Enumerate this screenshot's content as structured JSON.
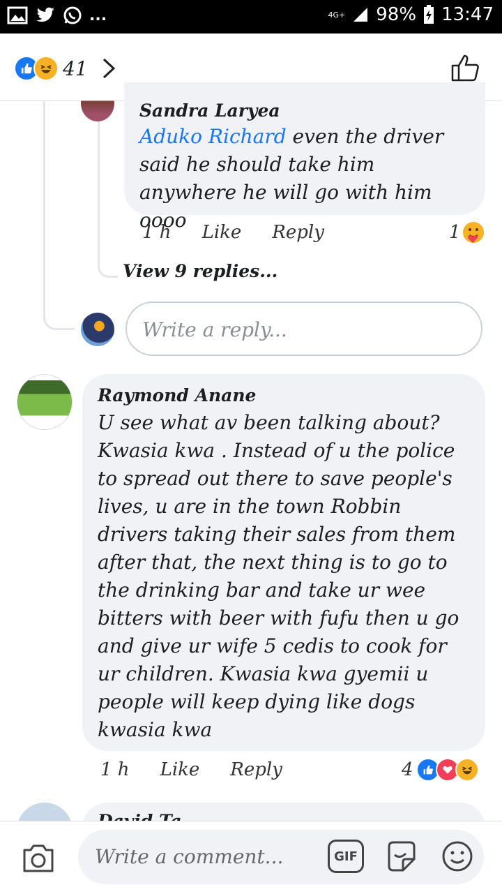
{
  "status_bar": {
    "network": "4G+",
    "battery": "98%",
    "time": "13:47",
    "more": "..."
  },
  "header": {
    "reaction_count": "41",
    "reaction_icons": [
      "like-icon",
      "haha-icon"
    ]
  },
  "reply_comment": {
    "author": "Sandra Laryea",
    "mention": "Aduko Richard",
    "text": " even the driver said he should take him anywhere he will go with him oooo",
    "time": "1 h",
    "like_label": "Like",
    "reply_label": "Reply",
    "reaction_count": "1"
  },
  "view_replies": "View 9 replies...",
  "reply_input": {
    "placeholder": "Write a reply..."
  },
  "main_comment": {
    "author": "Raymond Anane",
    "text": "U see what av been talking about? Kwasia kwa . Instead of u the police to spread out there to save people's lives, u are in the town Robbin drivers taking their sales from them after that, the next thing is to go to the drinking bar and take ur wee bitters with beer with fufu then u go and give ur wife 5 cedis to cook for ur children. Kwasia kwa gyemii u people will keep dying like dogs kwasia kwa",
    "time": "1 h",
    "like_label": "Like",
    "reply_label": "Reply",
    "reaction_count": "4"
  },
  "next_comment": {
    "author_partial": "David Ta..."
  },
  "bottom_bar": {
    "placeholder": "Write a comment...",
    "gif_label": "GIF"
  },
  "colors": {
    "accent": "#1877f2",
    "bubble": "#f0f2f5",
    "love": "#f33e58",
    "haha": "#f7b125"
  }
}
